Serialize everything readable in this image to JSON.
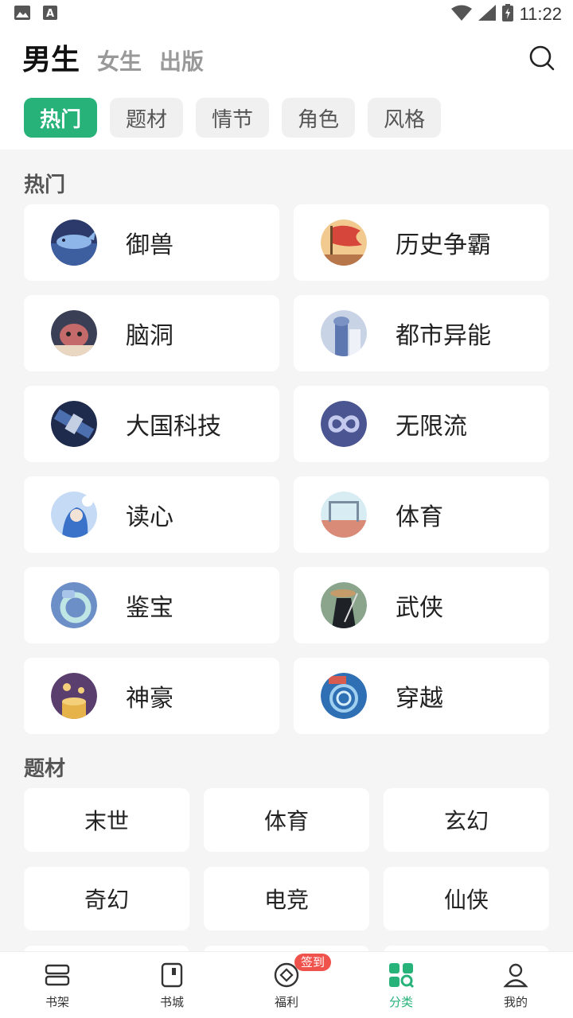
{
  "status_bar": {
    "time": "11:22"
  },
  "header": {
    "gender_tabs": [
      {
        "label": "男生",
        "active": true
      },
      {
        "label": "女生",
        "active": false
      },
      {
        "label": "出版",
        "active": false
      }
    ],
    "search_icon": "search-icon",
    "filter_chips": [
      {
        "label": "热门",
        "active": true
      },
      {
        "label": "题材",
        "active": false
      },
      {
        "label": "情节",
        "active": false
      },
      {
        "label": "角色",
        "active": false
      },
      {
        "label": "风格",
        "active": false
      }
    ]
  },
  "hot_section": {
    "title": "热门",
    "items": [
      {
        "label": "御兽",
        "icon": "whale-icon"
      },
      {
        "label": "历史争霸",
        "icon": "flag-icon"
      },
      {
        "label": "脑洞",
        "icon": "brain-creature-icon"
      },
      {
        "label": "都市异能",
        "icon": "tower-icon"
      },
      {
        "label": "大国科技",
        "icon": "satellite-icon"
      },
      {
        "label": "无限流",
        "icon": "infinity-icon"
      },
      {
        "label": "读心",
        "icon": "mind-reading-girl-icon"
      },
      {
        "label": "体育",
        "icon": "goal-icon"
      },
      {
        "label": "鉴宝",
        "icon": "jade-ring-icon"
      },
      {
        "label": "武侠",
        "icon": "swordsman-icon"
      },
      {
        "label": "神豪",
        "icon": "gold-coins-icon"
      },
      {
        "label": "穿越",
        "icon": "time-portal-icon"
      }
    ]
  },
  "subject_section": {
    "title": "题材",
    "items": [
      {
        "label": "末世"
      },
      {
        "label": "体育"
      },
      {
        "label": "玄幻"
      },
      {
        "label": "奇幻"
      },
      {
        "label": "电竞"
      },
      {
        "label": "仙侠"
      }
    ]
  },
  "bottom_nav": {
    "items": [
      {
        "label": "书架",
        "icon": "bookshelf-icon",
        "active": false
      },
      {
        "label": "书城",
        "icon": "bookstore-icon",
        "active": false
      },
      {
        "label": "福利",
        "icon": "coin-icon",
        "active": false,
        "badge": "签到"
      },
      {
        "label": "分类",
        "icon": "category-icon",
        "active": true
      },
      {
        "label": "我的",
        "icon": "profile-icon",
        "active": false
      }
    ]
  },
  "colors": {
    "accent": "#27b27a",
    "badge": "#f0524c"
  }
}
